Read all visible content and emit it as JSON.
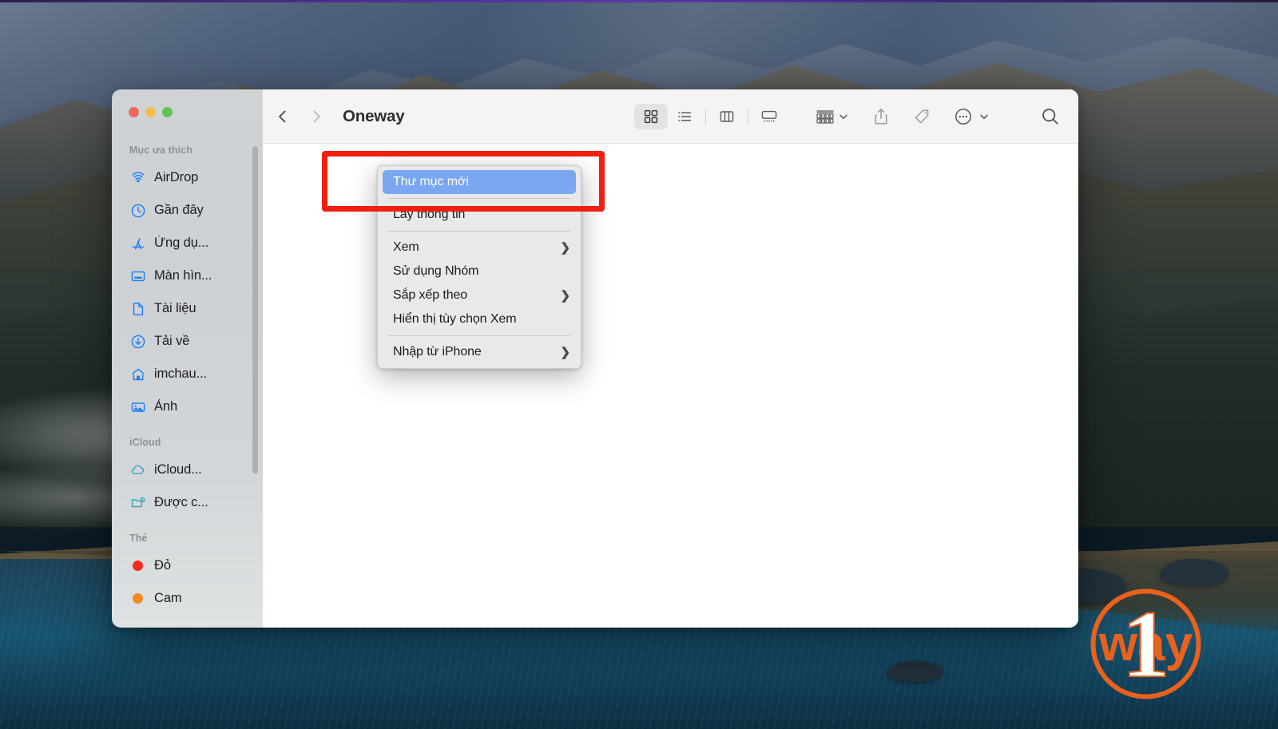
{
  "desktop": {
    "wallpaper_name": "big-sur-mountains",
    "top_edge_color": "#4a2f8a"
  },
  "window": {
    "title": "Oneway",
    "traffic_lights": [
      {
        "name": "close",
        "color": "#ec6a5f"
      },
      {
        "name": "minimize",
        "color": "#f4bd4f"
      },
      {
        "name": "zoom",
        "color": "#61c454"
      }
    ]
  },
  "sidebar": {
    "sections": [
      {
        "header": "Mục ưa thích",
        "items": [
          {
            "label": "AirDrop",
            "icon": "airdrop-icon"
          },
          {
            "label": "Gần đây",
            "icon": "clock-icon"
          },
          {
            "label": "Ứng dụ...",
            "icon": "applications-icon"
          },
          {
            "label": "Màn hìn...",
            "icon": "desktop-icon"
          },
          {
            "label": "Tài liệu",
            "icon": "document-icon"
          },
          {
            "label": "Tải về",
            "icon": "downloads-icon"
          },
          {
            "label": "imchau...",
            "icon": "home-icon"
          },
          {
            "label": "Ảnh",
            "icon": "photos-icon"
          }
        ]
      },
      {
        "header": "iCloud",
        "items": [
          {
            "label": "iCloud...",
            "icon": "icloud-icon"
          },
          {
            "label": "Được c...",
            "icon": "shared-folder-icon"
          }
        ]
      },
      {
        "header": "Thẻ",
        "items": [
          {
            "label": "Đỏ",
            "icon": "tag-dot-icon",
            "color": "#f42b21"
          },
          {
            "label": "Cam",
            "icon": "tag-dot-icon",
            "color": "#ef8b20"
          }
        ]
      }
    ]
  },
  "toolbar": {
    "back_label": "Quay lại",
    "forward_label": "Tiến",
    "view_buttons": [
      {
        "name": "icon-view",
        "selected": true
      },
      {
        "name": "list-view",
        "selected": false
      },
      {
        "name": "column-view",
        "selected": false
      },
      {
        "name": "gallery-view",
        "selected": false
      }
    ],
    "group_button": "group-by",
    "share_button": "share",
    "tags_button": "tags",
    "more_button": "more-actions",
    "search_button": "search"
  },
  "context_menu": {
    "items": [
      {
        "label": "Thư mục mới",
        "selected": true,
        "submenu": false
      },
      {
        "separator": true
      },
      {
        "label": "Lấy thông tin",
        "selected": false,
        "submenu": false
      },
      {
        "separator": true
      },
      {
        "label": "Xem",
        "selected": false,
        "submenu": true
      },
      {
        "label": "Sử dụng Nhóm",
        "selected": false,
        "submenu": false
      },
      {
        "label": "Sắp xếp theo",
        "selected": false,
        "submenu": true
      },
      {
        "label": "Hiển thị tùy chọn Xem",
        "selected": false,
        "submenu": false
      },
      {
        "separator": true
      },
      {
        "label": "Nhập từ iPhone",
        "selected": false,
        "submenu": true
      }
    ],
    "highlight_color": "#7aa7f0",
    "submenu_arrow": "❯"
  },
  "annotation": {
    "type": "rectangle-highlight",
    "color": "#f01f10"
  },
  "watermark": {
    "text_way": "way",
    "text_one": "1",
    "color": "#e8621e"
  }
}
